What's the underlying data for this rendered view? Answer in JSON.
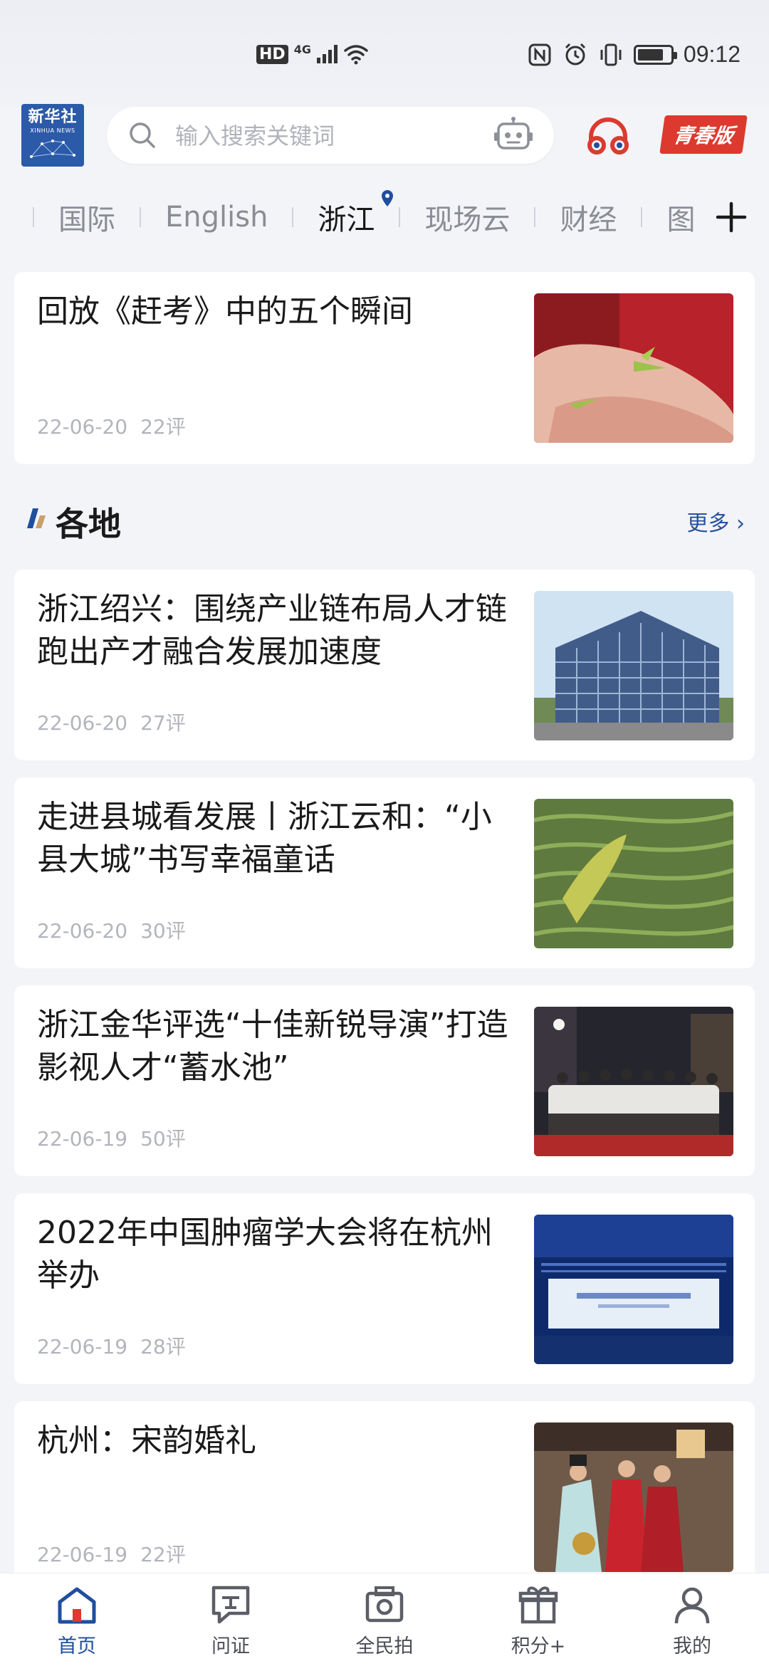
{
  "status_bar": {
    "hd": "HD",
    "network": "4G",
    "time": "09:12",
    "battery_level": 0.8
  },
  "header": {
    "logo_cn": "新华社",
    "logo_en": "XINHUA NEWS",
    "search_placeholder": "输入搜索关键词",
    "youth_label": "青春版"
  },
  "tabs": [
    {
      "label": "国际"
    },
    {
      "label": "English"
    },
    {
      "label": "浙江",
      "active": true
    },
    {
      "label": "现场云"
    },
    {
      "label": "财经"
    },
    {
      "label": "图"
    }
  ],
  "top_article": {
    "title": "回放《赶考》中的五个瞬间",
    "date": "22-06-20",
    "comments": "22评"
  },
  "section": {
    "title": "各地",
    "more": "更多 ›"
  },
  "articles": [
    {
      "title": "浙江绍兴：围绕产业链布局人才链跑出产才融合发展加速度",
      "date": "22-06-20",
      "comments": "27评"
    },
    {
      "title": "走进县城看发展丨浙江云和：“小县大城”书写幸福童话",
      "date": "22-06-20",
      "comments": "30评"
    },
    {
      "title": "浙江金华评选“十佳新锐导演”打造影视人才“蓄水池”",
      "date": "22-06-19",
      "comments": "50评"
    },
    {
      "title": "2022年中国肿瘤学大会将在杭州举办",
      "date": "22-06-19",
      "comments": "28评"
    },
    {
      "title": "杭州：宋韵婚礼",
      "date": "22-06-19",
      "comments": "22评"
    }
  ],
  "bottom_nav": [
    {
      "label": "首页",
      "icon": "home-icon",
      "active": true
    },
    {
      "label": "问证",
      "icon": "ask-icon"
    },
    {
      "label": "全民拍",
      "icon": "camera-icon"
    },
    {
      "label": "积分+",
      "icon": "gift-icon"
    },
    {
      "label": "我的",
      "icon": "profile-icon"
    }
  ],
  "colors": {
    "brand_blue": "#1f4e9e",
    "youth_red": "#dc3a2f",
    "background": "#f3f4f8"
  }
}
